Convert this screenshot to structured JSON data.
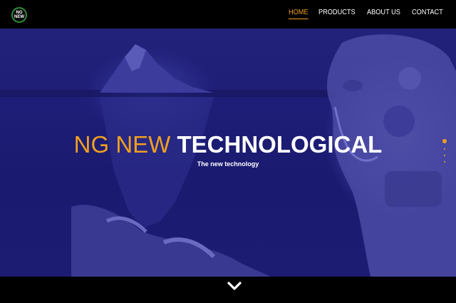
{
  "header": {
    "logo": {
      "line1": "NG",
      "line2": "NEW",
      "icon": "ng-new-logo"
    },
    "nav": [
      {
        "label": "HOME",
        "active": true
      },
      {
        "label": "PRODUCTS",
        "active": false
      },
      {
        "label": "ABOUT US",
        "active": false
      },
      {
        "label": "CONTACT",
        "active": false
      }
    ]
  },
  "hero": {
    "title_light": "NG NEW ",
    "title_bold": "TECHNOLOGICAL",
    "subtitle": "The new technology",
    "slide_indicator": {
      "count": 4,
      "active_index": 0
    }
  },
  "footer": {
    "scroll_icon": "chevron-down-icon"
  },
  "colors": {
    "accent": "#f0a020",
    "overlay": "#1e1e78",
    "header_bg": "#000000"
  }
}
